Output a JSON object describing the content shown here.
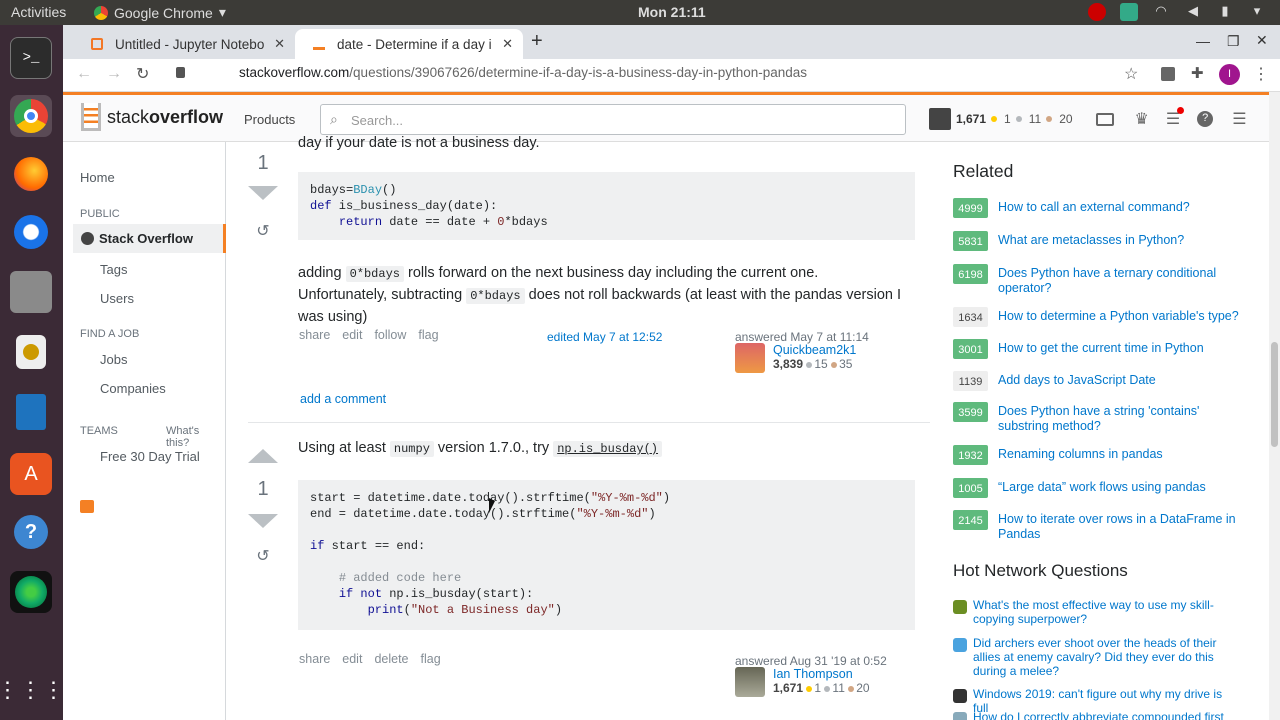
{
  "os": {
    "activities": "Activities",
    "app": "Google Chrome",
    "clock": "Mon 21:11"
  },
  "tabs": [
    {
      "label": "Untitled - Jupyter Notebo"
    },
    {
      "label": "date - Determine if a day i"
    }
  ],
  "url": {
    "host": "stackoverflow.com",
    "path": "/questions/39067626/determine-if-a-day-is-a-business-day-in-python-pandas"
  },
  "so": {
    "logo_a": "stack",
    "logo_b": "overflow",
    "products": "Products",
    "search_placeholder": "Search...",
    "rep": "1,671",
    "gold": "1",
    "silver": "11",
    "bronze": "20"
  },
  "nav": {
    "home": "Home",
    "public": "PUBLIC",
    "stack": "Stack Overflow",
    "tags": "Tags",
    "users": "Users",
    "findjob": "FIND A JOB",
    "jobs": "Jobs",
    "companies": "Companies",
    "teams": "TEAMS",
    "whats": "What's this?",
    "trial": "Free 30 Day Trial"
  },
  "a1": {
    "intro": "day if your date is not a business day.",
    "score": "1",
    "text1a": "adding ",
    "ic1": "0*bdays",
    "text1b": " rolls forward on the next business day including the current one. Unfortunately, subtracting ",
    "ic2": "0*bdays",
    "text1c": " does not roll backwards (at least with the pandas version I was using)",
    "links": [
      "share",
      "edit",
      "follow",
      "flag"
    ],
    "edited": "edited May 7 at 12:52",
    "answered": "answered May 7 at 11:14",
    "user": "Quickbeam2k1",
    "urep": "3,839",
    "us": "15",
    "ub": "35",
    "addc": "add a comment"
  },
  "a2": {
    "score": "1",
    "t1": "Using at least ",
    "ic1": "numpy",
    "t2": " version 1.7.0., try ",
    "ic2": "np.is_busday()",
    "links": [
      "share",
      "edit",
      "delete",
      "flag"
    ],
    "answered": "answered Aug 31 '19 at 0:52",
    "user": "Ian Thompson",
    "urep": "1,671",
    "ug": "1",
    "us": "11",
    "ub": "20"
  },
  "related": {
    "title": "Related",
    "items": [
      {
        "n": "4999",
        "t": "How to call an external command?",
        "g": true
      },
      {
        "n": "5831",
        "t": "What are metaclasses in Python?",
        "g": true
      },
      {
        "n": "6198",
        "t": "Does Python have a ternary conditional operator?",
        "g": true
      },
      {
        "n": "1634",
        "t": "How to determine a Python variable's type?",
        "g": false
      },
      {
        "n": "3001",
        "t": "How to get the current time in Python",
        "g": true
      },
      {
        "n": "1139",
        "t": "Add days to JavaScript Date",
        "g": false
      },
      {
        "n": "3599",
        "t": "Does Python have a string 'contains' substring method?",
        "g": true
      },
      {
        "n": "1932",
        "t": "Renaming columns in pandas",
        "g": true
      },
      {
        "n": "1005",
        "t": "“Large data” work flows using pandas",
        "g": true
      },
      {
        "n": "2145",
        "t": "How to iterate over rows in a DataFrame in Pandas",
        "g": true
      }
    ]
  },
  "hnq": {
    "title": "Hot Network Questions",
    "items": [
      "What's the most effective way to use my skill-copying superpower?",
      "Did archers ever shoot over the heads of their allies at enemy cavalry? Did they ever do this during a melee?",
      "Windows 2019: can't figure out why my drive is full",
      "How do I correctly abbreviate compounded first"
    ]
  }
}
